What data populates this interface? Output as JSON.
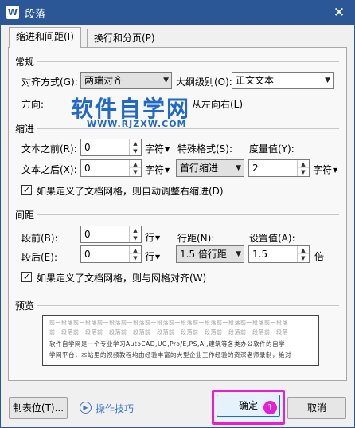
{
  "window": {
    "title": "段落",
    "app_icon_glyph": "W",
    "close_glyph": "✕"
  },
  "tabs": [
    {
      "label": "缩进和间距(I)",
      "active": true
    },
    {
      "label": "换行和分页(P)",
      "active": false
    }
  ],
  "general": {
    "section": "常规",
    "align_label": "对齐方式(G):",
    "align_value": "两端对齐",
    "outline_label": "大纲级别(O):",
    "outline_value": "正文文本",
    "direction_label": "方向:",
    "direction_option": "从左向右(L)"
  },
  "indent": {
    "section": "缩进",
    "before_label": "文本之前(R):",
    "before_value": "0",
    "before_unit": "字符",
    "after_label": "文本之后(X):",
    "after_value": "0",
    "after_unit": "字符",
    "special_label": "特殊格式(S):",
    "special_value": "首行缩进",
    "measure_label": "度量值(Y):",
    "measure_value": "2",
    "measure_unit": "字符",
    "grid_checkbox": "如果定义了文档网格，则自动调整右缩进(D)",
    "grid_checked": true
  },
  "spacing": {
    "section": "间距",
    "before_label": "段前(B):",
    "before_value": "0",
    "before_unit": "行",
    "after_label": "段后(E):",
    "after_value": "0",
    "after_unit": "行",
    "line_label": "行距(N):",
    "line_value": "1.5 倍行距",
    "setting_label": "设置值(A):",
    "setting_value": "1.5",
    "setting_unit": "倍",
    "grid_checkbox": "如果定义了文档网格，则与网格对齐(W)",
    "grid_checked": true
  },
  "preview": {
    "section": "预览",
    "lines": [
      "前一段落前一段落前一段落前一段落前一段落前一段落前一段落前一段落前一段落前一段落",
      "前一段落前一段落前一段落前一段落前一段落前一段落前一段落前一段落前一段落前一段落",
      "软件自学网是一个专业学习AutoCAD,UG,Pro/E,PS,AI,建筑等各类办公软件的自学",
      "学网平台，本站里的视频教程均由经验丰富的大型企业工作经验的资深老师录制，绝对"
    ]
  },
  "watermark": {
    "main": "软件自学网",
    "url": "WWW.RJZXW.COM"
  },
  "buttons": {
    "tabs_stops": "制表位(T)...",
    "tips": "操作技巧",
    "ok": "确定",
    "cancel": "取消"
  },
  "annotation": {
    "badge": "1",
    "color": "#e51fd7"
  },
  "colors": {
    "titlebar": "#2b5797",
    "watermark": "#2268c8",
    "link": "#3c7ad0"
  }
}
